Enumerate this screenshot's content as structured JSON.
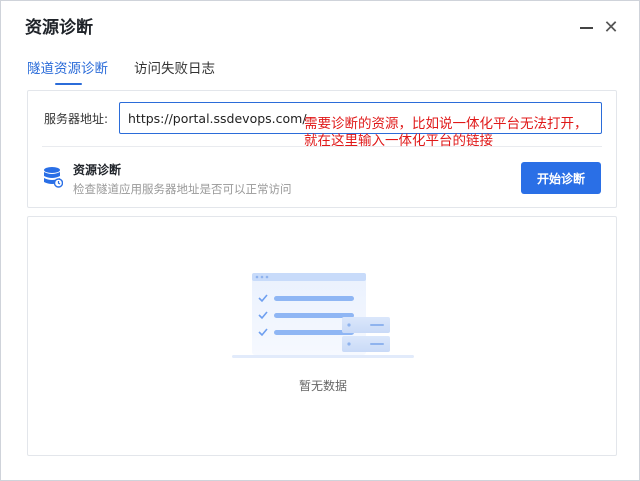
{
  "window": {
    "title": "资源诊断",
    "minimize_icon": "minimize-icon",
    "close_icon": "close-icon",
    "close_glyph": "✕"
  },
  "tabs": [
    {
      "label": "隧道资源诊断",
      "active": true
    },
    {
      "label": "访问失败日志",
      "active": false
    }
  ],
  "form": {
    "server_label": "服务器地址:",
    "server_value": "https://portal.ssdevops.com/"
  },
  "diagnosis": {
    "icon": "database-icon",
    "title": "资源诊断",
    "description": "检查隧道应用服务器地址是否可以正常访问",
    "start_button": "开始诊断"
  },
  "annotation": {
    "line1": "需要诊断的资源，比如说一体化平台无法打开，",
    "line2": "就在这里输入一体化平台的链接",
    "color": "#e01818"
  },
  "results": {
    "empty_icon": "empty-data-illustration",
    "empty_text": "暂无数据"
  },
  "colors": {
    "accent": "#2b6cd9",
    "button": "#2a6fe6"
  }
}
